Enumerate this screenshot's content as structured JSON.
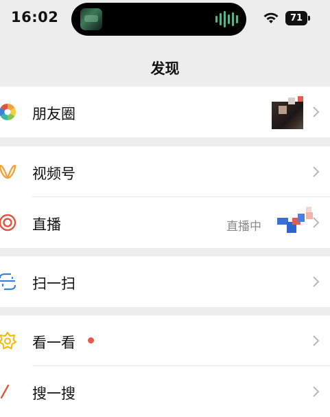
{
  "status": {
    "time": "16:02",
    "battery": "71"
  },
  "nav": {
    "title": "发现"
  },
  "items": [
    {
      "label": "朋友圈",
      "icon": "moments-icon"
    },
    {
      "label": "视频号",
      "icon": "channels-icon"
    },
    {
      "label": "直播",
      "icon": "live-icon",
      "extra": "直播中"
    },
    {
      "label": "扫一扫",
      "icon": "scan-icon"
    },
    {
      "label": "看一看",
      "icon": "top-stories-icon"
    },
    {
      "label": "搜一搜",
      "icon": "search-icon"
    }
  ],
  "colors": {
    "background": "#ededed",
    "unread_dot": "#e85a4f",
    "live": "#e0533d",
    "channels": "#f0a23b",
    "scan": "#3b82d6",
    "top_stories": "#f5b800"
  }
}
